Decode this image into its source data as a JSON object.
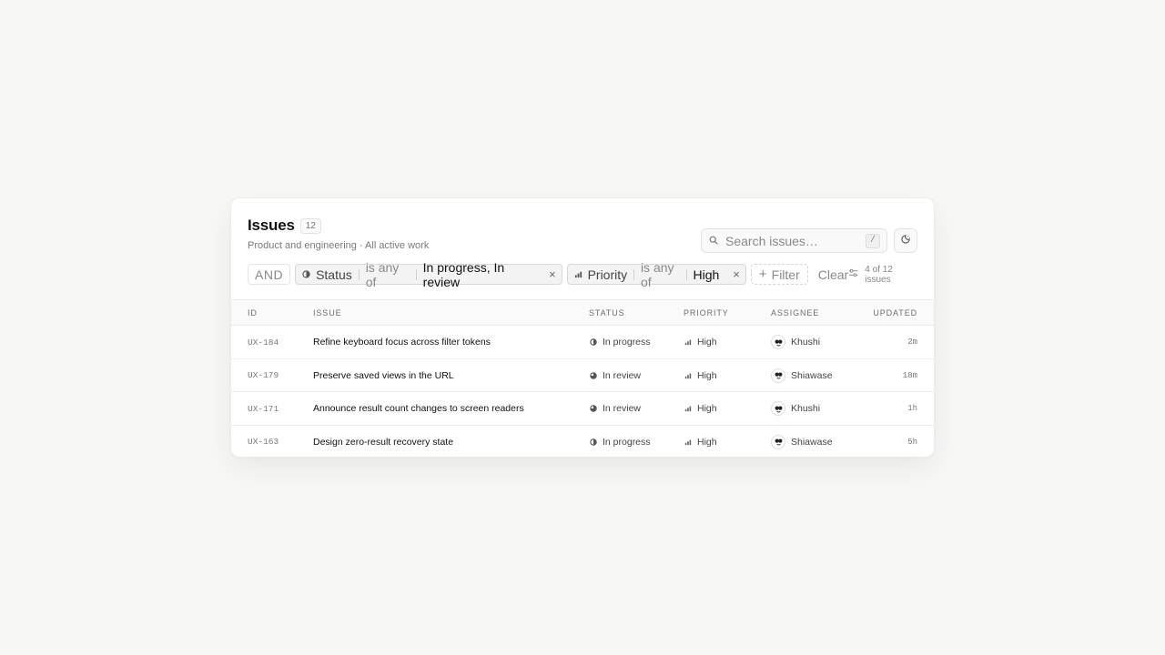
{
  "header": {
    "title": "Issues",
    "count": "12",
    "subtitle": "Product and engineering · All active work"
  },
  "search": {
    "placeholder": "Search issues…",
    "shortcut": "/",
    "icon": "search-icon"
  },
  "theme_toggle": {
    "icon": "theme-toggle-icon"
  },
  "filters": {
    "conjunction": "AND",
    "tokens": [
      {
        "field": "Status",
        "operator": "is any of",
        "value": "In progress, In review",
        "icon": "status-icon"
      },
      {
        "field": "Priority",
        "operator": "is any of",
        "value": "High",
        "icon": "priority-icon"
      }
    ],
    "add_label": "Filter",
    "clear_label": "Clear",
    "result_count": "4 of 12 issues"
  },
  "table": {
    "columns": [
      "ID",
      "ISSUE",
      "STATUS",
      "PRIORITY",
      "ASSIGNEE",
      "UPDATED"
    ],
    "rows": [
      {
        "id": "UX-184",
        "issue": "Refine keyboard focus across filter tokens",
        "status": "In progress",
        "priority": "High",
        "assignee": "Khushi",
        "updated": "2m"
      },
      {
        "id": "UX-179",
        "issue": "Preserve saved views in the URL",
        "status": "In review",
        "priority": "High",
        "assignee": "Shiawase",
        "updated": "18m"
      },
      {
        "id": "UX-171",
        "issue": "Announce result count changes to screen readers",
        "status": "In review",
        "priority": "High",
        "assignee": "Khushi",
        "updated": "1h"
      },
      {
        "id": "UX-163",
        "issue": "Design zero-result recovery state",
        "status": "In progress",
        "priority": "High",
        "assignee": "Shiawase",
        "updated": "5h"
      }
    ]
  },
  "colors": {
    "background": "#f7f7f6",
    "card": "#ffffff",
    "token_bg": "#f3f3f3",
    "text": "#111111",
    "muted": "#888888"
  }
}
